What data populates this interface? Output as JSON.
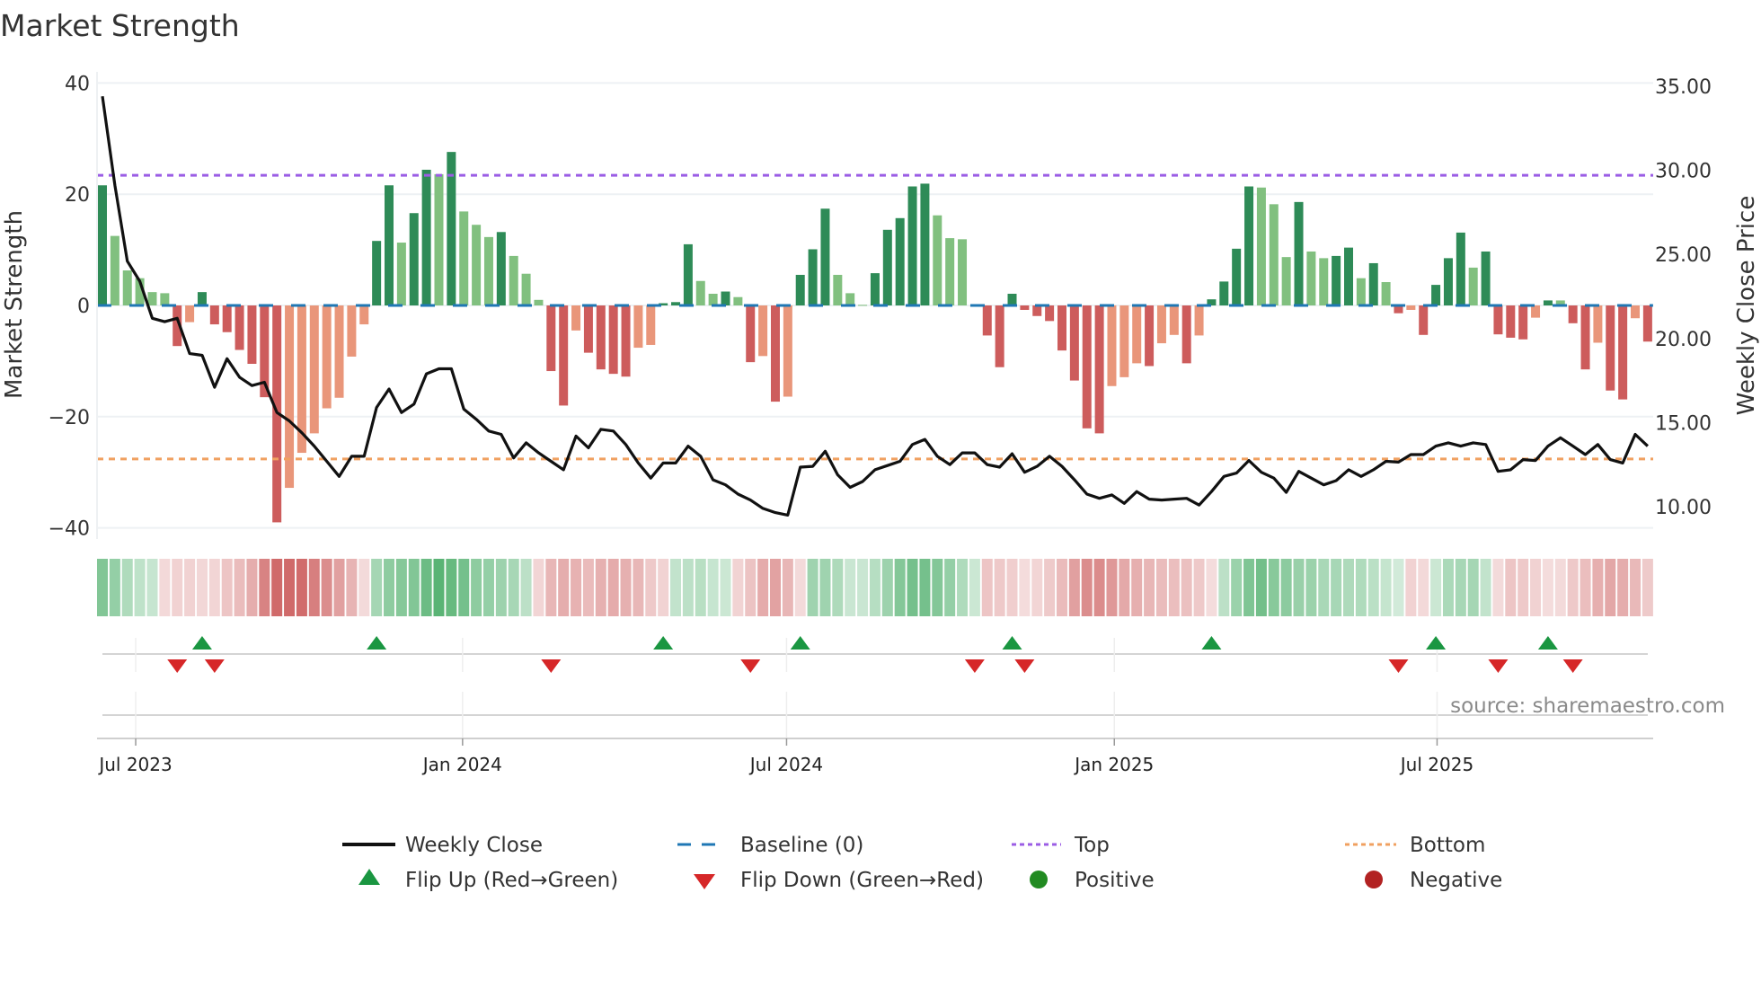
{
  "title": "Market Strength",
  "source": "source: sharemaestro.com",
  "colors": {
    "strong_up": "#2e8b57",
    "weak_up": "#81c07f",
    "strong_down": "#cd5c5c",
    "weak_down": "#e9967a",
    "baseline": "#1f77b4",
    "top": "#9b5de5",
    "bottom": "#f0a060",
    "close": "#111111",
    "flip_up": "#1a9641",
    "flip_down": "#d62728",
    "positive": "#228b22",
    "negative": "#b22222"
  },
  "chart_data": {
    "type": "bar",
    "title": "Market Strength",
    "ylabel": "Market Strength",
    "ylabel_right": "Weekly Close Price",
    "y_left": {
      "range": [
        -42,
        42
      ],
      "ticks": [
        40,
        20,
        0,
        -20,
        -40
      ],
      "labels": [
        "40",
        "20",
        "0",
        "−20",
        "−40"
      ]
    },
    "y_right": {
      "range": [
        8.08,
        35.85
      ],
      "ticks": [
        35,
        30,
        25,
        20,
        15,
        10
      ],
      "labels": [
        "35.00",
        "30.00",
        "25.00",
        "20.00",
        "15.00",
        "10.00"
      ]
    },
    "x_ticks": [
      {
        "label": "Jul 2023",
        "week": 2.67
      },
      {
        "label": "Jan 2024",
        "week": 28.9
      },
      {
        "label": "Jul 2024",
        "week": 54.9
      },
      {
        "label": "Jan 2025",
        "week": 81.2
      },
      {
        "label": "Jul 2025",
        "week": 107.1
      }
    ],
    "top_level": 23.4,
    "bottom_level": -27.6,
    "baseline": 0,
    "strength": [
      21.6,
      12.5,
      6.3,
      4.9,
      2.4,
      2.2,
      -7.3,
      -3.0,
      2.4,
      -3.4,
      -4.8,
      -8.0,
      -10.5,
      -16.5,
      -39.0,
      -32.8,
      -26.5,
      -23.0,
      -18.5,
      -16.6,
      -9.2,
      -3.4,
      11.6,
      21.6,
      11.3,
      16.6,
      24.4,
      23.6,
      27.6,
      16.9,
      14.5,
      12.3,
      13.2,
      8.9,
      5.7,
      1.0,
      -11.8,
      -18.0,
      -4.5,
      -8.5,
      -11.5,
      -12.3,
      -12.8,
      -7.6,
      -7.1,
      0.4,
      0.6,
      11.0,
      4.4,
      2.1,
      2.5,
      1.5,
      -10.2,
      -9.1,
      -17.3,
      -16.4,
      5.5,
      10.1,
      17.4,
      5.5,
      2.2,
      0.1,
      5.8,
      13.6,
      15.7,
      21.4,
      21.9,
      16.2,
      12.1,
      11.9,
      -0.2,
      -5.4,
      -11.1,
      2.1,
      -0.8,
      -1.9,
      -2.8,
      -8.1,
      -13.5,
      -22.1,
      -23.0,
      -14.5,
      -12.9,
      -10.4,
      -10.9,
      -6.8,
      -5.3,
      -10.4,
      -5.4,
      1.1,
      4.3,
      10.2,
      21.4,
      21.2,
      18.2,
      8.7,
      18.6,
      9.7,
      8.5,
      8.9,
      10.4,
      4.9,
      7.6,
      4.2,
      -1.4,
      -0.8,
      -5.3,
      3.7,
      8.5,
      13.1,
      6.8,
      9.7,
      -5.2,
      -5.8,
      -6.1,
      -2.2,
      0.9,
      0.9,
      -3.2,
      -11.5,
      -6.7,
      -15.3,
      -16.9,
      -2.3,
      -6.5
    ],
    "weekly_close": [
      34.4,
      29.1,
      24.6,
      23.4,
      21.2,
      21.0,
      21.2,
      19.1,
      19.0,
      17.1,
      18.8,
      17.7,
      17.2,
      17.4,
      15.6,
      15.1,
      14.4,
      13.6,
      12.7,
      11.8,
      13.0,
      13.0,
      15.9,
      17.0,
      15.6,
      16.1,
      17.9,
      18.2,
      18.2,
      15.8,
      15.2,
      14.5,
      14.3,
      12.9,
      13.8,
      13.2,
      12.7,
      12.2,
      14.2,
      13.5,
      14.6,
      14.5,
      13.7,
      12.6,
      11.7,
      12.6,
      12.6,
      13.6,
      13.0,
      11.6,
      11.3,
      10.75,
      10.4,
      9.9,
      9.65,
      9.5,
      12.35,
      12.4,
      13.3,
      11.9,
      11.15,
      11.5,
      12.2,
      12.45,
      12.7,
      13.7,
      14.0,
      13.0,
      12.5,
      13.2,
      13.2,
      12.5,
      12.35,
      13.15,
      12.05,
      12.4,
      13.0,
      12.4,
      11.6,
      10.75,
      10.5,
      10.7,
      10.2,
      10.9,
      10.45,
      10.4,
      10.45,
      10.5,
      10.1,
      10.9,
      11.8,
      12.0,
      12.75,
      12.05,
      11.7,
      10.85,
      12.1,
      11.7,
      11.3,
      11.55,
      12.2,
      11.8,
      12.2,
      12.7,
      12.65,
      13.1,
      13.1,
      13.6,
      13.8,
      13.6,
      13.8,
      13.7,
      12.1,
      12.2,
      12.8,
      12.75,
      13.6,
      14.1,
      13.6,
      13.1,
      13.7,
      12.8,
      12.6,
      14.3,
      13.6
    ],
    "flip_up_weeks": [
      8,
      22,
      45,
      56,
      73,
      89,
      107,
      116
    ],
    "flip_down_weeks": [
      6,
      9,
      36,
      52,
      70,
      74,
      104,
      112,
      118
    ],
    "legend": {
      "weekly_close": "Weekly Close",
      "baseline": "Baseline (0)",
      "top": "Top",
      "bottom": "Bottom",
      "flip_up": "Flip Up (Red→Green)",
      "flip_down": "Flip Down (Green→Red)",
      "positive": "Positive",
      "negative": "Negative"
    },
    "legend_position": "bottom-center"
  }
}
